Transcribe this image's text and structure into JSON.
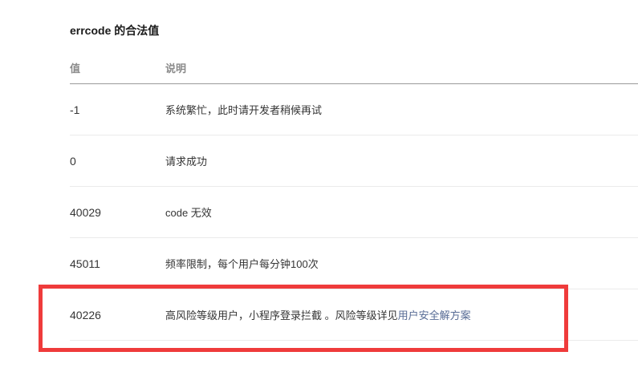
{
  "section": {
    "title": "errcode 的合法值"
  },
  "table": {
    "headers": {
      "value": "值",
      "description": "说明"
    },
    "rows": [
      {
        "value": "-1",
        "description": "系统繁忙，此时请开发者稍候再试"
      },
      {
        "value": "0",
        "description": "请求成功"
      },
      {
        "value": "40029",
        "description": "code 无效"
      },
      {
        "value": "45011",
        "description": "频率限制，每个用户每分钟100次"
      },
      {
        "value": "40226",
        "description": "高风险等级用户，小程序登录拦截 。风险等级详见",
        "link": "用户安全解方案"
      }
    ]
  },
  "colors": {
    "highlight": "#ef3b3b",
    "link": "#576b95"
  }
}
